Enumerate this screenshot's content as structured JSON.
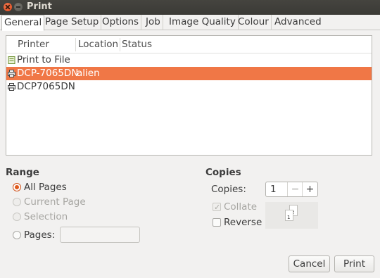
{
  "window": {
    "title": "Print"
  },
  "tabs": [
    {
      "label": "General",
      "active": true
    },
    {
      "label": "Page Setup"
    },
    {
      "label": "Options"
    },
    {
      "label": "Job"
    },
    {
      "label": "Image Quality"
    },
    {
      "label": "Colour"
    },
    {
      "label": "Advanced"
    }
  ],
  "printer_list": {
    "columns": [
      "Printer",
      "Location",
      "Status"
    ],
    "rows": [
      {
        "name": "Print to File",
        "location": "",
        "status": "",
        "icon": "file-icon",
        "selected": false
      },
      {
        "name": "DCP-7065DN",
        "location": "alien",
        "status": "",
        "icon": "printer-icon",
        "selected": true
      },
      {
        "name": "DCP7065DN",
        "location": "",
        "status": "",
        "icon": "printer-icon",
        "selected": false
      }
    ]
  },
  "range": {
    "title": "Range",
    "options": [
      {
        "label": "All Pages",
        "checked": true,
        "disabled": false
      },
      {
        "label": "Current Page",
        "checked": false,
        "disabled": true
      },
      {
        "label": "Selection",
        "checked": false,
        "disabled": true
      },
      {
        "label": "Pages:",
        "checked": false,
        "disabled": false
      }
    ],
    "pages_value": ""
  },
  "copies": {
    "title": "Copies",
    "label": "Copies:",
    "value": "1",
    "minus": "−",
    "plus": "+",
    "collate": {
      "label": "Collate",
      "checked": true,
      "disabled": true
    },
    "reverse": {
      "label": "Reverse",
      "checked": false,
      "disabled": false
    },
    "preview_pages": [
      "1",
      "2"
    ]
  },
  "buttons": {
    "cancel": "Cancel",
    "print": "Print"
  },
  "colors": {
    "selection": "#f07746",
    "radio_accent": "#df5a1d",
    "titlebar": "#3b3a36"
  }
}
